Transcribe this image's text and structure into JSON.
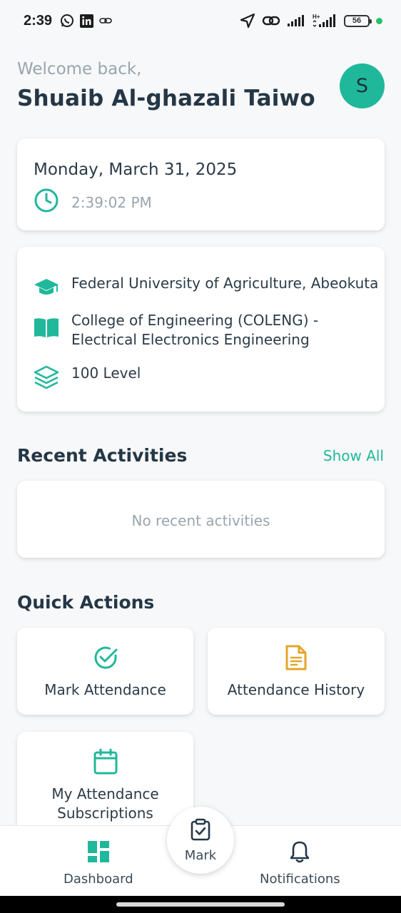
{
  "status_bar": {
    "time": "2:39",
    "battery": "56",
    "network": "H+",
    "icons_left": [
      "whatsapp-icon",
      "linkedin-icon",
      "link-icon"
    ],
    "icons_right": [
      "location-icon",
      "hotspot-icon",
      "signal-icon",
      "signal-h-plus-icon",
      "battery-icon"
    ]
  },
  "header": {
    "welcome": "Welcome back,",
    "user_name": "Shuaib Al-ghazali Taiwo",
    "avatar_initial": "S"
  },
  "date_card": {
    "date": "Monday, March 31, 2025",
    "time": "2:39:02 PM"
  },
  "info_card": {
    "university": "Federal University of Agriculture, Abeokuta",
    "college_line1": "College of Engineering (COLENG) -",
    "college_line2": "Electrical Electronics Engineering",
    "level": "100 Level"
  },
  "recent_activities": {
    "title": "Recent Activities",
    "show_all": "Show All",
    "empty": "No recent activities"
  },
  "quick_actions": {
    "title": "Quick Actions",
    "items": [
      {
        "label": "Mark Attendance",
        "icon": "check-circle-icon"
      },
      {
        "label": "Attendance History",
        "icon": "document-icon"
      },
      {
        "label_line1": "My Attendance",
        "label_line2": "Subscriptions",
        "icon": "calendar-icon"
      }
    ]
  },
  "bottom_nav": {
    "dashboard": "Dashboard",
    "mark": "Mark",
    "notifications": "Notifications"
  },
  "colors": {
    "accent": "#20b89a",
    "orange": "#e3a62a",
    "text_dark": "#253746",
    "text_muted": "#9aa5ae"
  }
}
